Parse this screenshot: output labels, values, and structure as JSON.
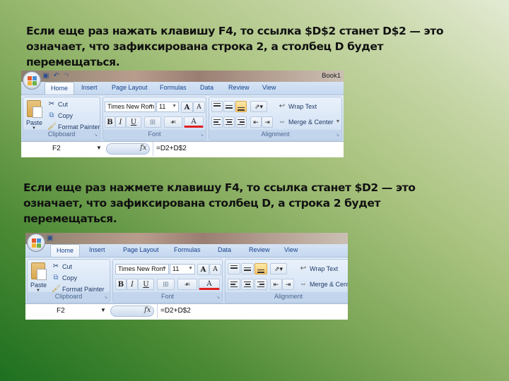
{
  "paragraphs": {
    "first": "Если  еще раз нажать клавишу F4, то ссылка $D$2 станет D$2 — это означает, что зафиксирована строка 2, а столбец D будет перемещаться.",
    "second": "Если еще раз нажмете клавишу F4, то ссылка станет $D2 — это означает, что зафиксирована столбец D, а строка 2 будет перемещаться."
  },
  "excel": {
    "title": "Book1",
    "tabs": [
      "Home",
      "Insert",
      "Page Layout",
      "Formulas",
      "Data",
      "Review",
      "View"
    ],
    "active_tab": "Home",
    "clipboard": {
      "paste": "Paste",
      "cut": "Cut",
      "copy": "Copy",
      "format_painter": "Format Painter",
      "group_label": "Clipboard"
    },
    "font": {
      "font_name": "Times New Rom",
      "font_size": "11",
      "bold": "B",
      "italic": "I",
      "underline": "U",
      "grow": "A",
      "shrink": "A",
      "font_color": "A",
      "group_label": "Font"
    },
    "alignment": {
      "wrap_text": "Wrap Text",
      "merge_center": "Merge & Center",
      "group_label": "Alignment"
    },
    "formula_bar": {
      "name_box": "F2",
      "fx": "fx",
      "formula": "=D2+D$2"
    }
  },
  "colors": {
    "ribbon_bg": "#dbe6f4",
    "tab_text": "#15428b",
    "highlight": "#f8c66a",
    "font_color_bar": "#e02020"
  }
}
